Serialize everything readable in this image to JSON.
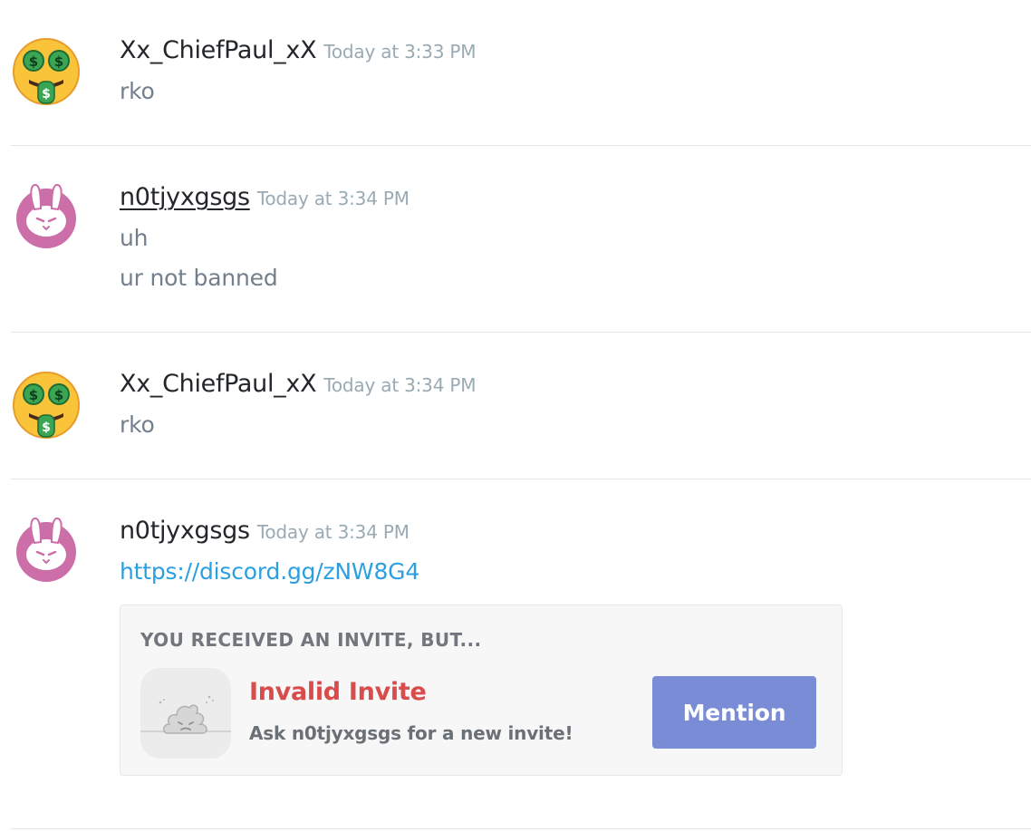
{
  "messages": [
    {
      "username": "Xx_ChiefPaul_xX",
      "timestamp": "Today at 3:33 PM",
      "avatar_icon": "money-mouth-face-icon",
      "lines": [
        "rko"
      ]
    },
    {
      "username": "n0tjyxgsgs",
      "timestamp": "Today at 3:34 PM",
      "avatar_icon": "bunny-icon",
      "lines": [
        "uh",
        "ur not banned"
      ]
    },
    {
      "username": "Xx_ChiefPaul_xX",
      "timestamp": "Today at 3:34 PM",
      "avatar_icon": "money-mouth-face-icon",
      "lines": [
        "rko"
      ]
    },
    {
      "username": "n0tjyxgsgs",
      "timestamp": "Today at 3:34 PM",
      "avatar_icon": "bunny-icon",
      "link": "https://discord.gg/zNW8G4"
    }
  ],
  "invite": {
    "header": "YOU RECEIVED AN INVITE, BUT...",
    "icon": "poop-icon",
    "title": "Invalid Invite",
    "subtitle": "Ask n0tjyxgsgs for a new invite!",
    "button_label": "Mention"
  },
  "colors": {
    "link": "#2b9fe0",
    "invalid": "#d84c4c",
    "button": "#7a8cd6",
    "avatar_ring": "#cc6ea8"
  }
}
